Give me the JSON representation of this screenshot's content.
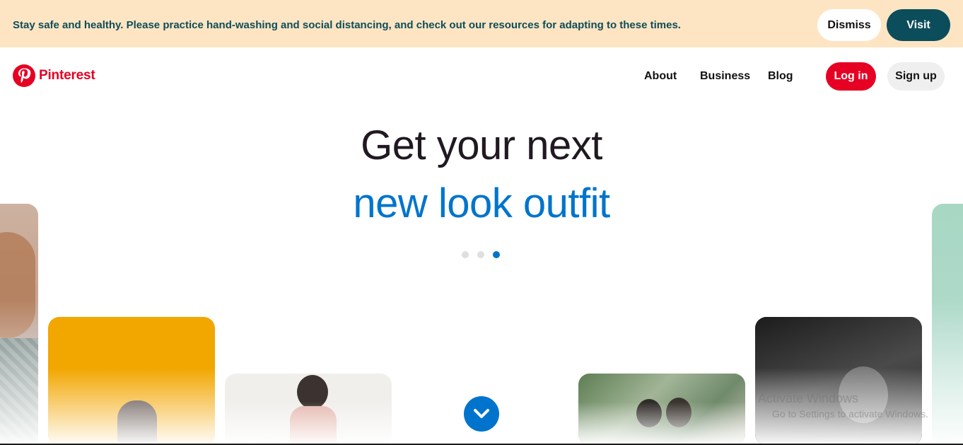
{
  "banner": {
    "message": "Stay safe and healthy. Please practice hand-washing and social distancing, and check out our resources for adapting to these times.",
    "dismiss_label": "Dismiss",
    "visit_label": "Visit"
  },
  "header": {
    "logo_text": "Pinterest",
    "nav": [
      "About",
      "Business",
      "Blog"
    ],
    "login_label": "Log in",
    "signup_label": "Sign up"
  },
  "hero": {
    "line1": "Get your next",
    "line2": "new look outfit",
    "carousel_active_index": 2,
    "carousel_count": 3
  },
  "colors": {
    "brand": "#e60023",
    "accent_blue": "#0074cc",
    "banner_bg": "#fde5c4",
    "banner_text": "#0f4d57",
    "visit_bg": "#0c4d5b"
  },
  "icons": {
    "logo": "pinterest-p-icon",
    "scroll": "chevron-down-icon"
  },
  "watermark": {
    "title": "Activate Windows",
    "subtitle": "Go to Settings to activate Windows."
  }
}
